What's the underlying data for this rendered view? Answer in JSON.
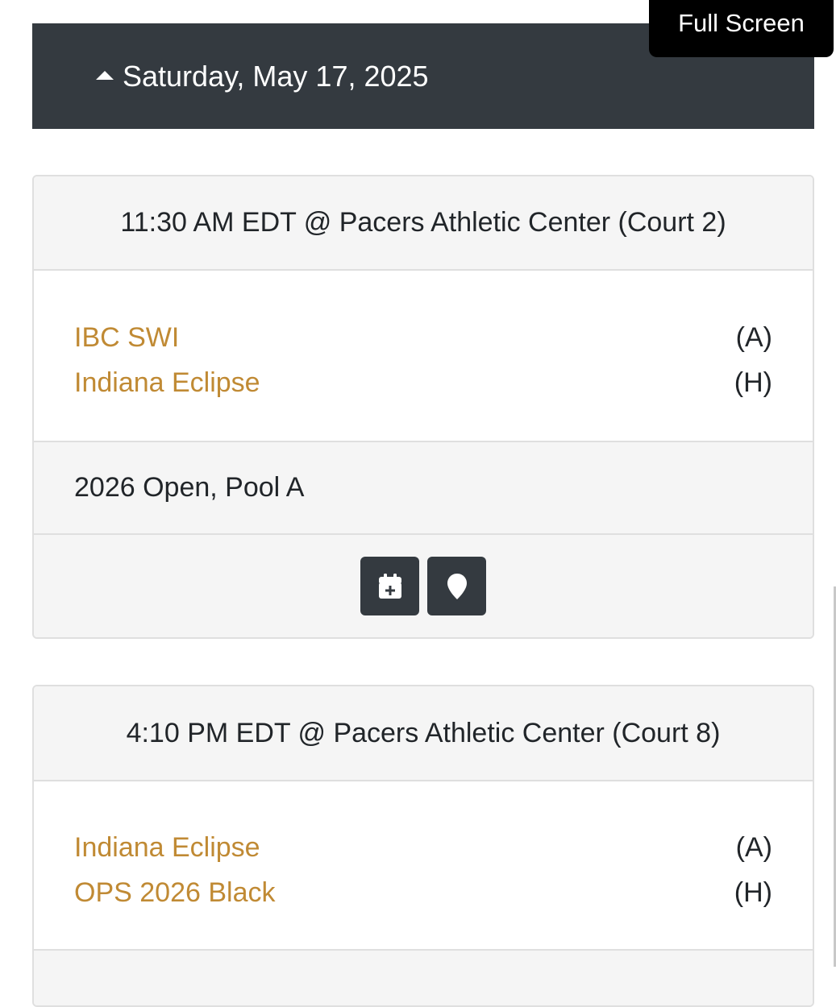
{
  "fullscreen": {
    "label": "Full Screen"
  },
  "date_header": {
    "label": "Saturday, May 17, 2025",
    "icon": "caret-up-icon"
  },
  "games": [
    {
      "header": "11:30 AM EDT @ Pacers Athletic Center (Court 2)",
      "teams": [
        {
          "name": "IBC SWI",
          "side": "(A)"
        },
        {
          "name": "Indiana Eclipse",
          "side": "(H)"
        }
      ],
      "division": "2026 Open, Pool A",
      "actions": [
        {
          "icon": "calendar-plus-icon"
        },
        {
          "icon": "map-marker-icon"
        }
      ]
    },
    {
      "header": "4:10 PM EDT @ Pacers Athletic Center (Court 8)",
      "teams": [
        {
          "name": "Indiana Eclipse",
          "side": "(A)"
        },
        {
          "name": "OPS 2026 Black",
          "side": "(H)"
        }
      ]
    }
  ],
  "colors": {
    "header_bg": "#343a40",
    "team_link": "#c08a34",
    "card_bg": "#f5f5f5",
    "border": "#dfdfdf"
  }
}
